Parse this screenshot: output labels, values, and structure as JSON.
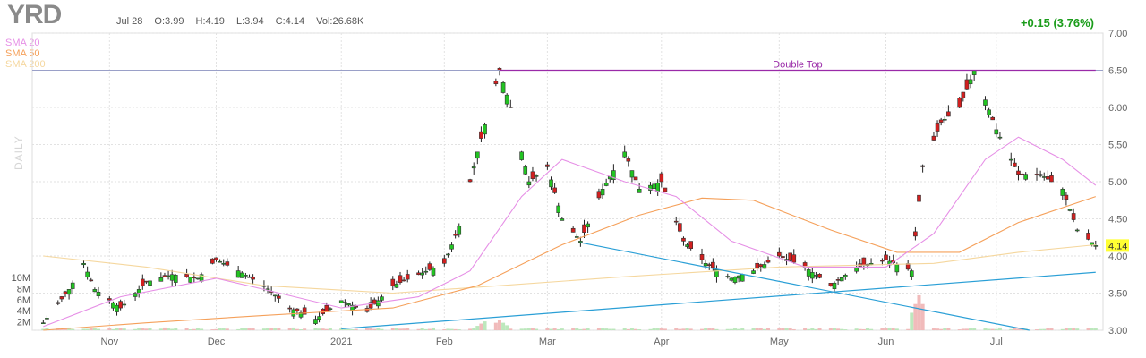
{
  "header": {
    "ticker": "YRD",
    "date": "Jul 28",
    "open": "O:3.99",
    "high": "H:4.19",
    "low": "L:3.94",
    "close": "C:4.14",
    "volume": "Vol:26.68K",
    "change": "+0.15 (3.76%)",
    "period": "DAILY"
  },
  "legend": [
    {
      "label": "SMA 20",
      "color": "#e68fe6"
    },
    {
      "label": "SMA 50",
      "color": "#f5a05a"
    },
    {
      "label": "SMA 200",
      "color": "#f5d79e"
    }
  ],
  "colors": {
    "up": "#22c422",
    "down": "#d21f1f",
    "trend": "#2a9fd6",
    "resistance": "#9a2aa8",
    "price_flag": "#ffff33"
  },
  "chart_data": {
    "type": "candlestick",
    "ylim": [
      3.0,
      7.0
    ],
    "price_ticks": [
      "3.00",
      "3.50",
      "4.00",
      "4.50",
      "5.00",
      "5.50",
      "6.00",
      "6.50",
      "7.00"
    ],
    "month_labels": [
      {
        "label": "Nov",
        "date": "2020-11-02"
      },
      {
        "label": "Dec",
        "date": "2020-12-01"
      },
      {
        "label": "2021",
        "date": "2021-01-04"
      },
      {
        "label": "Feb",
        "date": "2021-02-01"
      },
      {
        "label": "Mar",
        "date": "2021-03-01"
      },
      {
        "label": "Apr",
        "date": "2021-04-01"
      },
      {
        "label": "May",
        "date": "2021-05-03"
      },
      {
        "label": "Jun",
        "date": "2021-06-01"
      },
      {
        "label": "Jul",
        "date": "2021-07-01"
      }
    ],
    "volume_ticks": [
      "2M",
      "4M",
      "6M",
      "8M",
      "10M"
    ],
    "last_price": "4.14",
    "annotations": [
      {
        "label": "Double Top",
        "price": 6.5,
        "start": "2021-02-16",
        "end": "2021-07-28"
      }
    ],
    "trendlines": [
      {
        "start": {
          "date": "2021-01-04",
          "price": 3.02
        },
        "end": {
          "date": "2021-07-28",
          "price": 3.78
        }
      },
      {
        "start": {
          "date": "2021-03-10",
          "price": 4.18
        },
        "end": {
          "date": "2021-07-10",
          "price": 3.0
        }
      }
    ],
    "volume_peaks": [
      {
        "date": "2021-02-12",
        "value": 1.6
      },
      {
        "date": "2021-02-16",
        "value": 1.8
      },
      {
        "date": "2021-06-10",
        "value": 6.3
      }
    ],
    "closes": [
      {
        "date": "2020-10-15",
        "close": 3.1
      },
      {
        "date": "2020-10-22",
        "close": 3.55
      },
      {
        "date": "2020-10-26",
        "close": 3.9
      },
      {
        "date": "2020-10-29",
        "close": 3.55
      },
      {
        "date": "2020-11-05",
        "close": 3.3
      },
      {
        "date": "2020-11-12",
        "close": 3.65
      },
      {
        "date": "2020-11-19",
        "close": 3.75
      },
      {
        "date": "2020-11-26",
        "close": 3.7
      },
      {
        "date": "2020-12-01",
        "close": 3.95
      },
      {
        "date": "2020-12-07",
        "close": 3.8
      },
      {
        "date": "2020-12-14",
        "close": 3.6
      },
      {
        "date": "2020-12-21",
        "close": 3.3
      },
      {
        "date": "2020-12-28",
        "close": 3.15
      },
      {
        "date": "2021-01-04",
        "close": 3.4
      },
      {
        "date": "2021-01-11",
        "close": 3.25
      },
      {
        "date": "2021-01-18",
        "close": 3.6
      },
      {
        "date": "2021-01-25",
        "close": 3.75
      },
      {
        "date": "2021-02-01",
        "close": 3.9
      },
      {
        "date": "2021-02-05",
        "close": 4.4
      },
      {
        "date": "2021-02-10",
        "close": 5.4
      },
      {
        "date": "2021-02-16",
        "close": 6.5
      },
      {
        "date": "2021-02-19",
        "close": 6.0
      },
      {
        "date": "2021-02-24",
        "close": 5.0
      },
      {
        "date": "2021-03-01",
        "close": 5.2
      },
      {
        "date": "2021-03-05",
        "close": 4.5
      },
      {
        "date": "2021-03-10",
        "close": 4.2
      },
      {
        "date": "2021-03-16",
        "close": 4.9
      },
      {
        "date": "2021-03-22",
        "close": 5.4
      },
      {
        "date": "2021-03-26",
        "close": 4.9
      },
      {
        "date": "2021-04-01",
        "close": 5.0
      },
      {
        "date": "2021-04-07",
        "close": 4.2
      },
      {
        "date": "2021-04-13",
        "close": 3.9
      },
      {
        "date": "2021-04-20",
        "close": 3.7
      },
      {
        "date": "2021-04-26",
        "close": 3.8
      },
      {
        "date": "2021-05-03",
        "close": 4.0
      },
      {
        "date": "2021-05-10",
        "close": 3.85
      },
      {
        "date": "2021-05-17",
        "close": 3.6
      },
      {
        "date": "2021-05-24",
        "close": 3.85
      },
      {
        "date": "2021-06-01",
        "close": 3.95
      },
      {
        "date": "2021-06-08",
        "close": 3.8
      },
      {
        "date": "2021-06-11",
        "close": 5.2
      },
      {
        "date": "2021-06-16",
        "close": 5.8
      },
      {
        "date": "2021-06-21",
        "close": 6.0
      },
      {
        "date": "2021-06-25",
        "close": 6.5
      },
      {
        "date": "2021-07-01",
        "close": 5.7
      },
      {
        "date": "2021-07-07",
        "close": 5.1
      },
      {
        "date": "2021-07-13",
        "close": 5.1
      },
      {
        "date": "2021-07-19",
        "close": 4.9
      },
      {
        "date": "2021-07-23",
        "close": 4.35
      },
      {
        "date": "2021-07-28",
        "close": 4.14
      }
    ],
    "sma20": [
      {
        "date": "2020-10-15",
        "v": 3.05
      },
      {
        "date": "2020-11-05",
        "v": 3.45
      },
      {
        "date": "2020-12-01",
        "v": 3.7
      },
      {
        "date": "2020-12-14",
        "v": 3.55
      },
      {
        "date": "2021-01-04",
        "v": 3.3
      },
      {
        "date": "2021-01-25",
        "v": 3.45
      },
      {
        "date": "2021-02-08",
        "v": 3.8
      },
      {
        "date": "2021-02-22",
        "v": 4.8
      },
      {
        "date": "2021-03-05",
        "v": 5.3
      },
      {
        "date": "2021-03-22",
        "v": 5.0
      },
      {
        "date": "2021-04-05",
        "v": 4.8
      },
      {
        "date": "2021-04-20",
        "v": 4.2
      },
      {
        "date": "2021-05-10",
        "v": 3.85
      },
      {
        "date": "2021-06-01",
        "v": 3.85
      },
      {
        "date": "2021-06-14",
        "v": 4.3
      },
      {
        "date": "2021-06-28",
        "v": 5.3
      },
      {
        "date": "2021-07-07",
        "v": 5.6
      },
      {
        "date": "2021-07-19",
        "v": 5.3
      },
      {
        "date": "2021-07-28",
        "v": 4.95
      }
    ],
    "sma50": [
      {
        "date": "2020-10-15",
        "v": 3.0
      },
      {
        "date": "2020-11-12",
        "v": 3.1
      },
      {
        "date": "2020-12-14",
        "v": 3.2
      },
      {
        "date": "2021-01-18",
        "v": 3.3
      },
      {
        "date": "2021-02-10",
        "v": 3.6
      },
      {
        "date": "2021-03-05",
        "v": 4.15
      },
      {
        "date": "2021-03-26",
        "v": 4.55
      },
      {
        "date": "2021-04-12",
        "v": 4.78
      },
      {
        "date": "2021-04-26",
        "v": 4.75
      },
      {
        "date": "2021-05-17",
        "v": 4.35
      },
      {
        "date": "2021-06-04",
        "v": 4.05
      },
      {
        "date": "2021-06-21",
        "v": 4.05
      },
      {
        "date": "2021-07-07",
        "v": 4.45
      },
      {
        "date": "2021-07-28",
        "v": 4.8
      }
    ],
    "sma200": [
      {
        "date": "2020-10-15",
        "v": 4.0
      },
      {
        "date": "2020-11-12",
        "v": 3.85
      },
      {
        "date": "2020-12-14",
        "v": 3.6
      },
      {
        "date": "2021-01-18",
        "v": 3.5
      },
      {
        "date": "2021-02-16",
        "v": 3.6
      },
      {
        "date": "2021-03-22",
        "v": 3.72
      },
      {
        "date": "2021-05-03",
        "v": 3.85
      },
      {
        "date": "2021-06-14",
        "v": 3.9
      },
      {
        "date": "2021-07-07",
        "v": 4.05
      },
      {
        "date": "2021-07-28",
        "v": 4.15
      }
    ]
  }
}
